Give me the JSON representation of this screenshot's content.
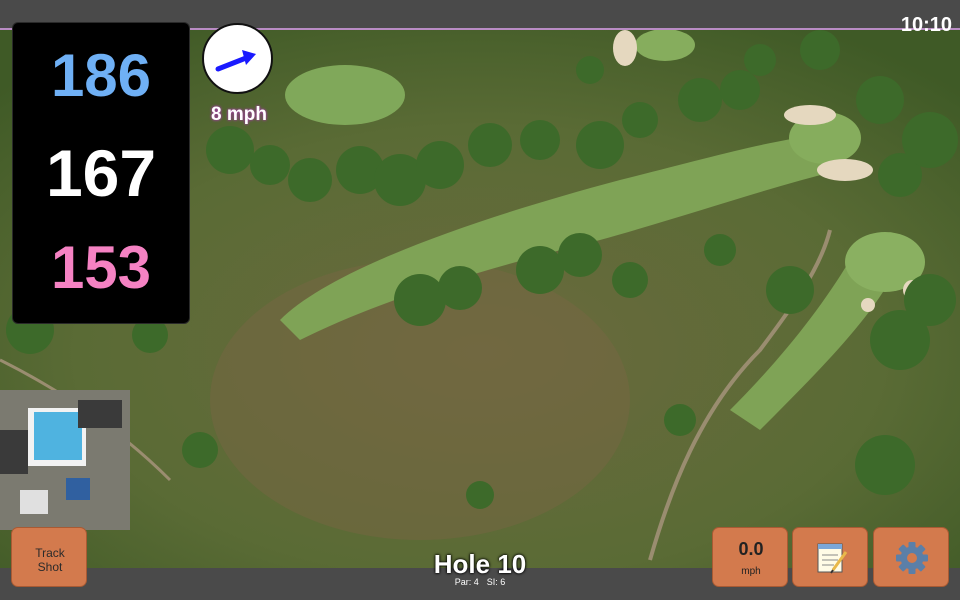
{
  "status": {
    "clock": "10:10"
  },
  "distances": {
    "back": "186",
    "middle": "167",
    "front": "153"
  },
  "wind": {
    "speed": "8 mph",
    "direction_icon": "wind-arrow-icon"
  },
  "track_button": {
    "line1": "Track",
    "line2": "Shot"
  },
  "speed_button": {
    "value": "0.0",
    "unit": "mph"
  },
  "notes_button": {
    "icon": "notepad-icon"
  },
  "settings_button": {
    "icon": "gear-icon"
  },
  "hole": {
    "title": "Hole 10",
    "par": "Par: 4",
    "si": "SI: 6"
  },
  "colors": {
    "back": "#6fb0f5",
    "middle": "#ffffff",
    "front": "#f582c3",
    "button": "#d37a4d",
    "wind_arrow": "#1a1aff"
  }
}
